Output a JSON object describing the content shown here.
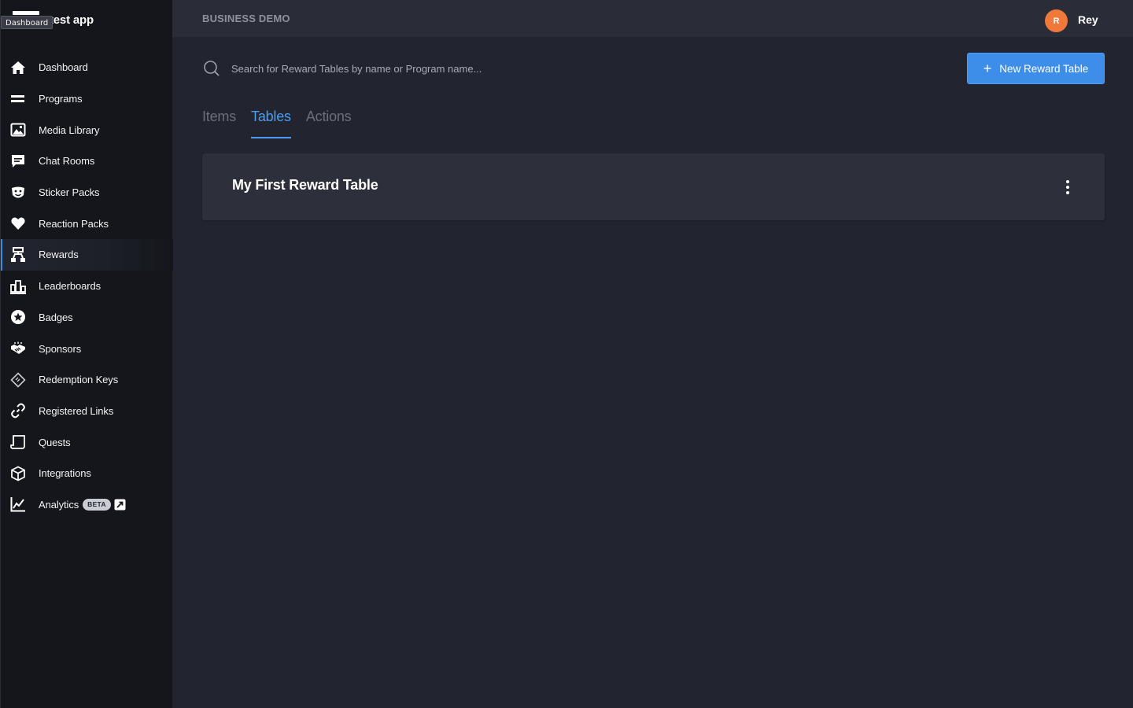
{
  "app": {
    "name": "test app",
    "tooltip": "Dashboard"
  },
  "topbar": {
    "org_name": "BUSINESS DEMO",
    "user_initial": "R",
    "user_name": "Rey"
  },
  "sidebar": {
    "items": [
      {
        "label": "Dashboard",
        "icon": "home-icon"
      },
      {
        "label": "Programs",
        "icon": "programs-icon"
      },
      {
        "label": "Media Library",
        "icon": "image-icon"
      },
      {
        "label": "Chat Rooms",
        "icon": "chat-icon"
      },
      {
        "label": "Sticker Packs",
        "icon": "sticker-icon"
      },
      {
        "label": "Reaction Packs",
        "icon": "heart-icon"
      },
      {
        "label": "Rewards",
        "icon": "rewards-icon",
        "active": true
      },
      {
        "label": "Leaderboards",
        "icon": "leaderboard-icon"
      },
      {
        "label": "Badges",
        "icon": "star-badge-icon"
      },
      {
        "label": "Sponsors",
        "icon": "handshake-icon"
      },
      {
        "label": "Redemption Keys",
        "icon": "ticket-icon"
      },
      {
        "label": "Registered Links",
        "icon": "link-icon"
      },
      {
        "label": "Quests",
        "icon": "scroll-icon"
      },
      {
        "label": "Integrations",
        "icon": "cube-icon"
      },
      {
        "label": "Analytics",
        "icon": "chart-line-icon",
        "badge": "BETA"
      }
    ]
  },
  "main": {
    "search": {
      "placeholder": "Search for Reward Tables by name or Program name...",
      "value": ""
    },
    "new_button_label": "New Reward Table",
    "tabs": [
      {
        "label": "Items",
        "active": false
      },
      {
        "label": "Tables",
        "active": true
      },
      {
        "label": "Actions",
        "active": false
      }
    ],
    "tables": [
      {
        "title": "My First Reward Table"
      }
    ]
  },
  "colors": {
    "accent": "#3d8ee8",
    "avatar": "#f0783a",
    "sidebar_bg": "#14161c",
    "main_bg": "#22252f"
  }
}
